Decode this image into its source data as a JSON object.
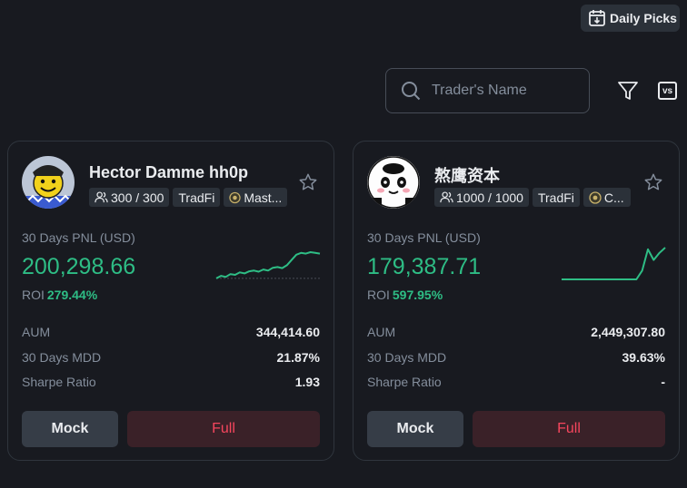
{
  "header": {
    "daily_picks_label": "Daily Picks",
    "search_placeholder": "Trader's Name",
    "vs_label": "vs"
  },
  "cards": [
    {
      "name": "Hector Damme hh0p",
      "copiers": "300 / 300",
      "tag_tradfi": "TradFi",
      "tag_badge": "Mast...",
      "pnl_label": "30 Days PNL (USD)",
      "pnl_value": "200,298.66",
      "roi_label": "ROI",
      "roi_value": "279.44%",
      "aum_label": "AUM",
      "aum_value": "344,414.60",
      "mdd_label": "30 Days MDD",
      "mdd_value": "21.87%",
      "sharpe_label": "Sharpe Ratio",
      "sharpe_value": "1.93",
      "mock_label": "Mock",
      "full_label": "Full",
      "sparkline": [
        0.08,
        0.15,
        0.12,
        0.2,
        0.18,
        0.25,
        0.22,
        0.28,
        0.3,
        0.27,
        0.33,
        0.3,
        0.38,
        0.4,
        0.37,
        0.45,
        0.6,
        0.75,
        0.8,
        0.78,
        0.82,
        0.8,
        0.78
      ]
    },
    {
      "name": "熬鹰资本",
      "copiers": "1000 / 1000",
      "tag_tradfi": "TradFi",
      "tag_badge": "C...",
      "pnl_label": "30 Days PNL (USD)",
      "pnl_value": "179,387.71",
      "roi_label": "ROI",
      "roi_value": "597.95%",
      "aum_label": "AUM",
      "aum_value": "2,449,307.80",
      "mdd_label": "30 Days MDD",
      "mdd_value": "39.63%",
      "sharpe_label": "Sharpe Ratio",
      "sharpe_value": "-",
      "mock_label": "Mock",
      "full_label": "Full",
      "sparkline": [
        0.05,
        0.05,
        0.05,
        0.05,
        0.05,
        0.05,
        0.05,
        0.05,
        0.05,
        0.05,
        0.05,
        0.05,
        0.05,
        0.05,
        0.3,
        0.9,
        0.6,
        0.8,
        0.95
      ]
    }
  ],
  "colors": {
    "background": "#181a20",
    "positive": "#2ebd85",
    "negative": "#f6465d",
    "muted": "#848e9c"
  }
}
